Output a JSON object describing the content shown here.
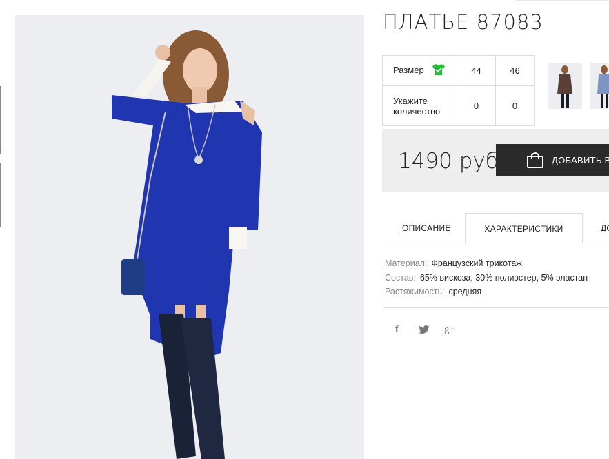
{
  "product": {
    "title": "ПЛАТЬЕ 87083",
    "size_label": "Размер",
    "qty_label_line1": "Укажите",
    "qty_label_line2": "количество",
    "sizes": [
      "44",
      "46"
    ],
    "quantities": [
      "0",
      "0"
    ],
    "price": "1490 руб",
    "cart_button": "ДОБАВИТЬ В"
  },
  "tabs": {
    "description": "ОПИСАНИЕ",
    "characteristics": "ХАРАКТЕРИСТИКИ",
    "third": "ДО"
  },
  "specs": [
    {
      "key": "Материал:",
      "value": "Французский трикотаж"
    },
    {
      "key": "Состав:",
      "value": "65% вискоза, 30% полиэстер, 5% эластан"
    },
    {
      "key": "Растяжимость:",
      "value": "средняя"
    }
  ],
  "social": {
    "facebook": "f",
    "twitter": "twitter-bird",
    "google": "g+"
  },
  "icons": {
    "size_chart": "tshirt-check-icon",
    "cart": "shopping-bag-icon"
  },
  "colors": {
    "dress_blue": "#2036b0",
    "accent_green": "#22c03a",
    "button_dark": "#2b2b2b"
  }
}
